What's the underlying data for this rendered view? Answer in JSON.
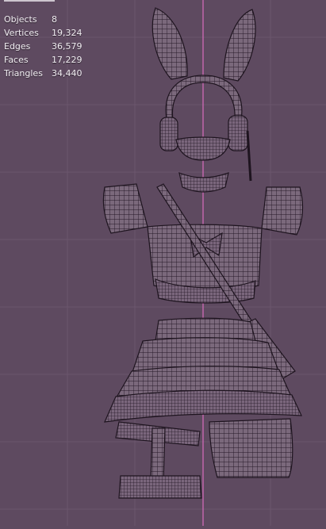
{
  "viewport": {
    "background": "#5e4a60",
    "grid_color": "#6a566c",
    "axis_color": "#c768b0",
    "wire_color": "#1e141f"
  },
  "stats": [
    {
      "label": "Objects",
      "value": "8"
    },
    {
      "label": "Vertices",
      "value": "19,324"
    },
    {
      "label": "Edges",
      "value": "36,579"
    },
    {
      "label": "Faces",
      "value": "17,229"
    },
    {
      "label": "Triangles",
      "value": "34,440"
    }
  ]
}
